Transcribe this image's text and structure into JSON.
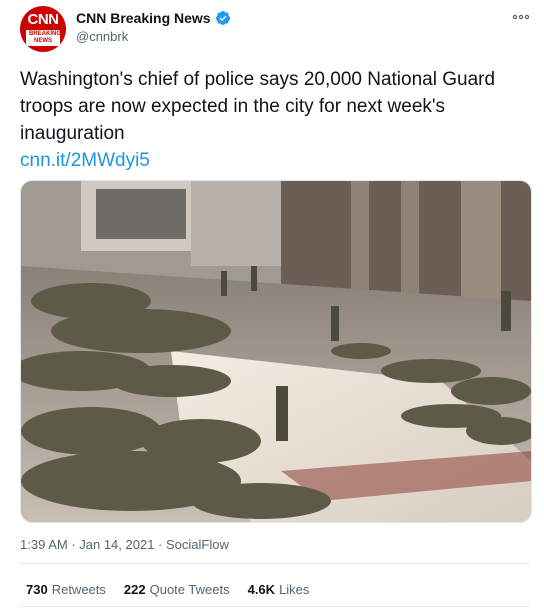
{
  "author": {
    "display_name": "CNN Breaking News",
    "handle": "@cnnbrk",
    "avatar_logo": "CNN",
    "avatar_badge": "BREAKING NEWS",
    "verified_icon": "verified-badge-icon",
    "verified_color": "#1d9bf0"
  },
  "tweet": {
    "text": "Washington's chief of police says 20,000 National Guard troops are now expected in the city for next week's inauguration",
    "link": "cnn.it/2MWdyi5",
    "link_color": "#1b95e0"
  },
  "media": {
    "type": "photo"
  },
  "meta": {
    "timestamp": "1:39 AM · Jan 14, 2021 · SocialFlow"
  },
  "stats": {
    "retweets_count": "730",
    "retweets_label": "Retweets",
    "quote_tweets_count": "222",
    "quote_tweets_label": "Quote Tweets",
    "likes_count": "4.6K",
    "likes_label": "Likes"
  },
  "icons": {
    "more": "more-options-icon"
  },
  "colors": {
    "brand_red": "#cc0000",
    "text_secondary": "#536471"
  }
}
